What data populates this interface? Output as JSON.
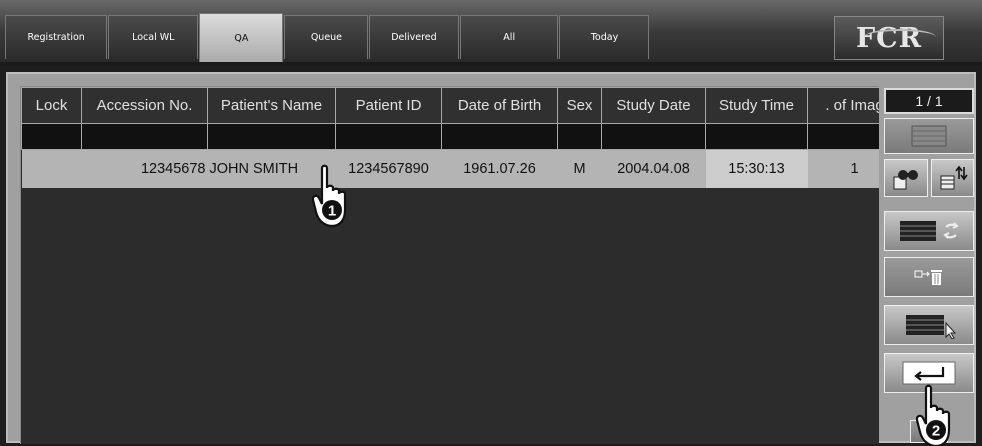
{
  "tabs": [
    {
      "label": "Registration",
      "active": false
    },
    {
      "label": "Local WL",
      "active": false
    },
    {
      "label": "QA",
      "active": true
    },
    {
      "label": "Queue",
      "active": false
    },
    {
      "label": "Delivered",
      "active": false
    },
    {
      "label": "All",
      "active": false
    },
    {
      "label": "Today",
      "active": false
    }
  ],
  "logo": {
    "text": "FCR"
  },
  "table": {
    "columns": [
      "Lock",
      "Accession No.",
      "Patient's Name",
      "Patient ID",
      "Date of Birth",
      "Sex",
      "Study Date",
      "Study Time",
      ". of Imag"
    ],
    "rows": [
      {
        "lock": "",
        "accession": "12345678",
        "name": "JOHN SMITH",
        "patient_id": "1234567890",
        "dob": "1961.07.26",
        "sex": "M",
        "study_date": "2004.04.08",
        "study_time": "15:30:13",
        "images": "1"
      }
    ]
  },
  "pager": {
    "text": "1 / 1"
  },
  "toolbar": {
    "icons": [
      "list-view-icon",
      "search-icon",
      "sort-icon",
      "refresh-list-icon",
      "move-to-trash-icon",
      "select-list-icon",
      "enter-icon"
    ]
  },
  "annotations": {
    "step1": "1",
    "step2": "2"
  }
}
